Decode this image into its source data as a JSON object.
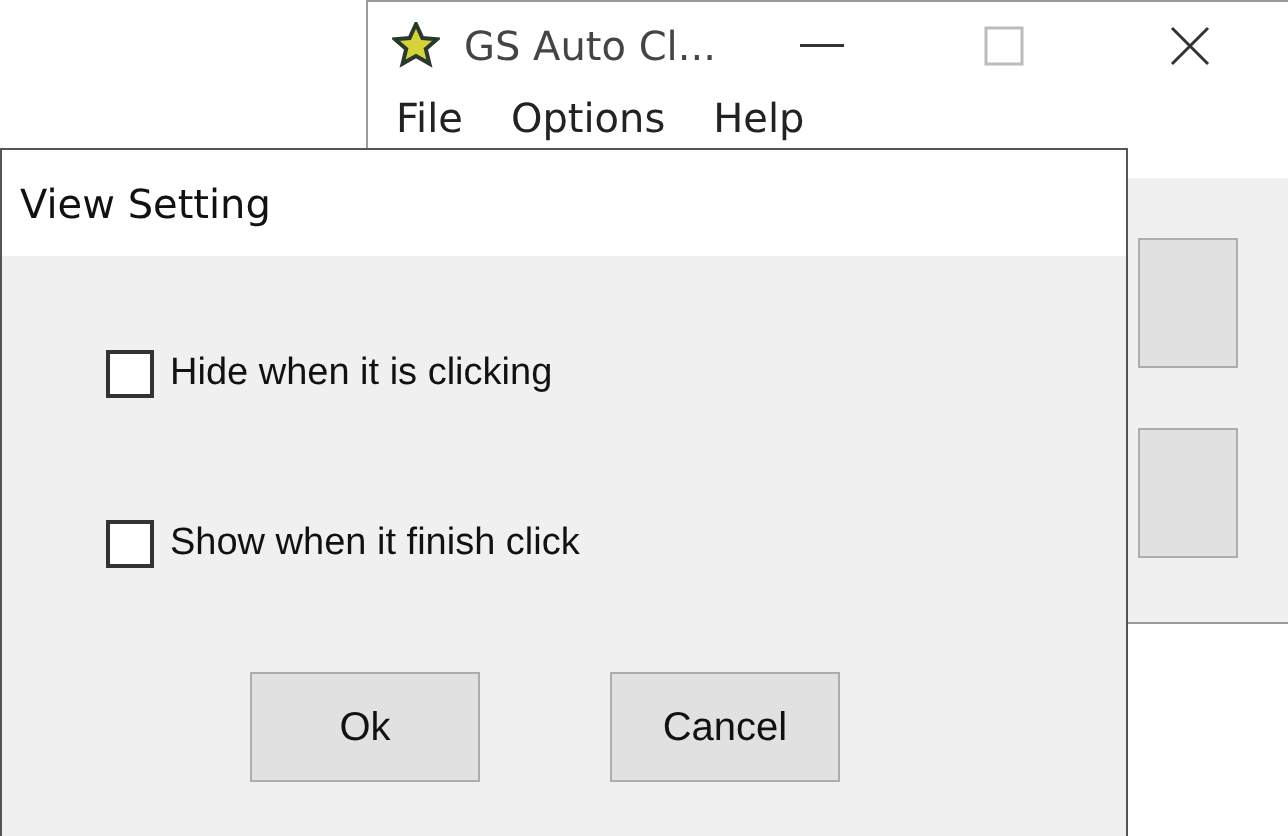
{
  "main_window": {
    "title": "GS Auto Cl...",
    "menu": [
      "File",
      "Options",
      "Help"
    ]
  },
  "dialog": {
    "title": "View Setting",
    "options": [
      {
        "label": "Hide when it is clicking",
        "checked": false
      },
      {
        "label": "Show when it finish click",
        "checked": false
      }
    ],
    "buttons": [
      "Ok",
      "Cancel"
    ]
  }
}
